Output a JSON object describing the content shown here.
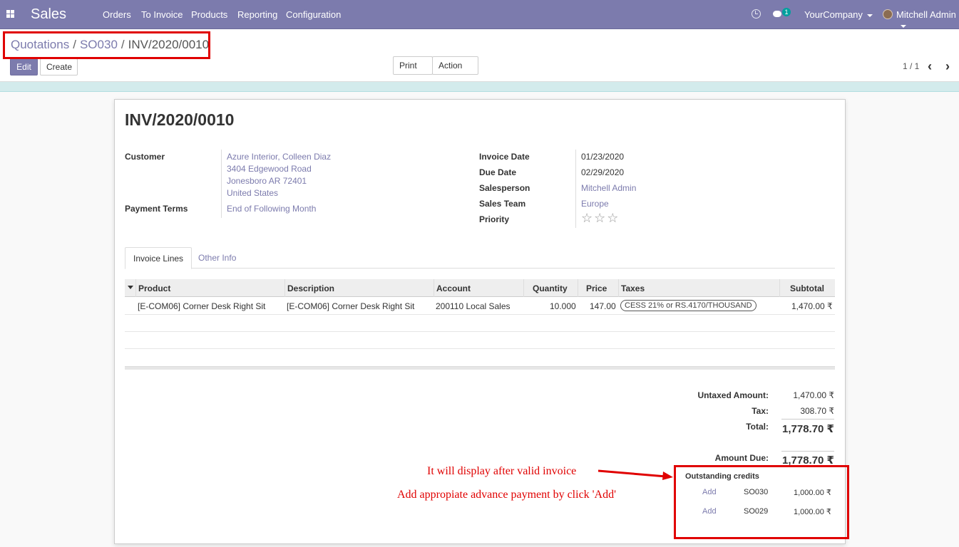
{
  "app": {
    "name": "Sales",
    "menu": [
      "Orders",
      "To Invoice",
      "Products",
      "Reporting",
      "Configuration"
    ],
    "messages_count": "1",
    "company": "YourCompany",
    "user": "Mitchell Admin"
  },
  "breadcrumb": [
    "Quotations",
    "SO030",
    "INV/2020/0010"
  ],
  "buttons": {
    "edit": "Edit",
    "create": "Create",
    "print": "Print",
    "action": "Action"
  },
  "pager": "1 / 1",
  "invoice": {
    "title": "INV/2020/0010",
    "customer_label": "Customer",
    "customer_lines": [
      "Azure Interior, Colleen Diaz",
      "3404 Edgewood Road",
      "Jonesboro AR 72401",
      "United States"
    ],
    "payment_terms_label": "Payment Terms",
    "payment_terms": "End of Following Month",
    "invoice_date_label": "Invoice Date",
    "invoice_date": "01/23/2020",
    "due_date_label": "Due Date",
    "due_date": "02/29/2020",
    "salesperson_label": "Salesperson",
    "salesperson": "Mitchell Admin",
    "sales_team_label": "Sales Team",
    "sales_team": "Europe",
    "priority_label": "Priority",
    "priority_stars": "☆☆☆"
  },
  "tabs": [
    "Invoice Lines",
    "Other Info"
  ],
  "table": {
    "columns": [
      "Product",
      "Description",
      "Account",
      "Quantity",
      "Price",
      "Taxes",
      "Subtotal"
    ],
    "rows": [
      {
        "product": "[E-COM06] Corner Desk Right Sit",
        "description": "[E-COM06] Corner Desk Right Sit",
        "account": "200110 Local Sales",
        "quantity": "10.000",
        "price": "147.00",
        "taxes": "CESS 21% or RS.4170/THOUSAND",
        "subtotal": "1,470.00 ₹"
      }
    ]
  },
  "totals": {
    "untaxed_label": "Untaxed Amount:",
    "untaxed": "1,470.00 ₹",
    "tax_label": "Tax:",
    "tax": "308.70 ₹",
    "total_label": "Total:",
    "total": "1,778.70 ₹",
    "amount_due_label": "Amount Due:",
    "amount_due": "1,778.70 ₹"
  },
  "credits": {
    "title": "Outstanding credits",
    "items": [
      {
        "action": "Add",
        "ref": "SO030",
        "amount": "1,000.00 ₹"
      },
      {
        "action": "Add",
        "ref": "SO029",
        "amount": "1,000.00 ₹"
      }
    ]
  },
  "annotations": {
    "note1": "It will display after valid invoice",
    "note2": "Add appropiate advance payment by click 'Add'",
    "color": "#e00000"
  },
  "colors": {
    "brand": "#7c7bad",
    "accent": "#00a09d"
  }
}
